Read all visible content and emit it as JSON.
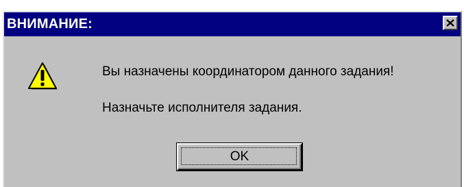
{
  "dialog": {
    "title": "ВНИМАНИЕ:",
    "close_icon": "close-icon",
    "icon": "warning-icon",
    "messages": [
      "Вы назначены координатором данного задания!",
      "Назначьте исполнителя задания."
    ],
    "ok_label": "OK"
  },
  "colors": {
    "titlebar": "#000080",
    "dialog_background": "#c0c0c0",
    "title_text": "#ffffff",
    "warning_fill": "#ffff00"
  }
}
